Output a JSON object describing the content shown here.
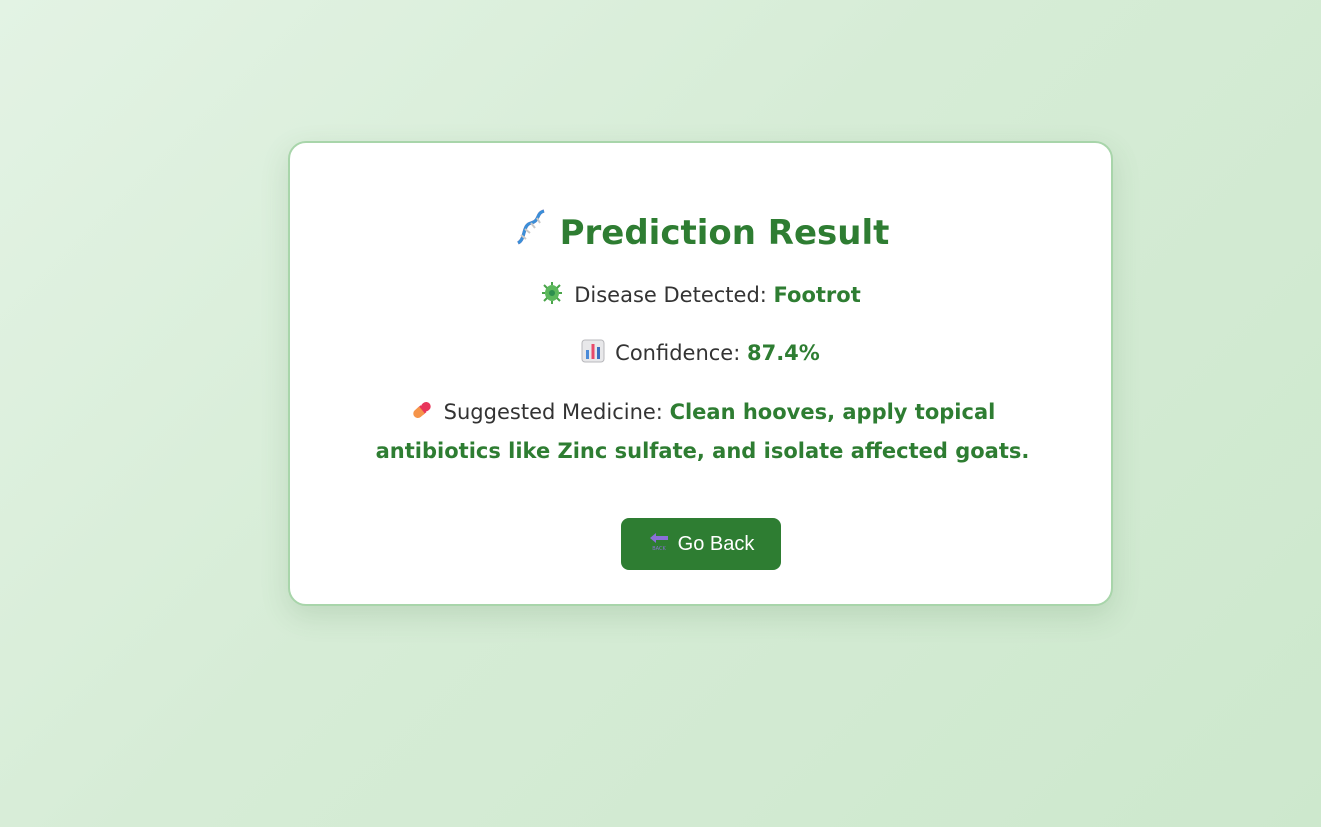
{
  "result": {
    "title": "Prediction Result",
    "title_icon": "dna-icon",
    "disease": {
      "icon": "microbe-icon",
      "label": "Disease Detected: ",
      "value": "Footrot"
    },
    "confidence": {
      "icon": "bar-chart-icon",
      "label": "Confidence: ",
      "value": "87.4%"
    },
    "medicine": {
      "icon": "pill-icon",
      "label": "Suggested Medicine: ",
      "value": "Clean hooves, apply topical antibiotics like Zinc sulfate, and isolate affected goats."
    },
    "back_button": {
      "icon": "back-arrow-icon",
      "label": "Go Back"
    }
  },
  "colors": {
    "accent": "#2e7d32",
    "card_border": "#a8d5aa",
    "background": "#d6ecd6"
  }
}
